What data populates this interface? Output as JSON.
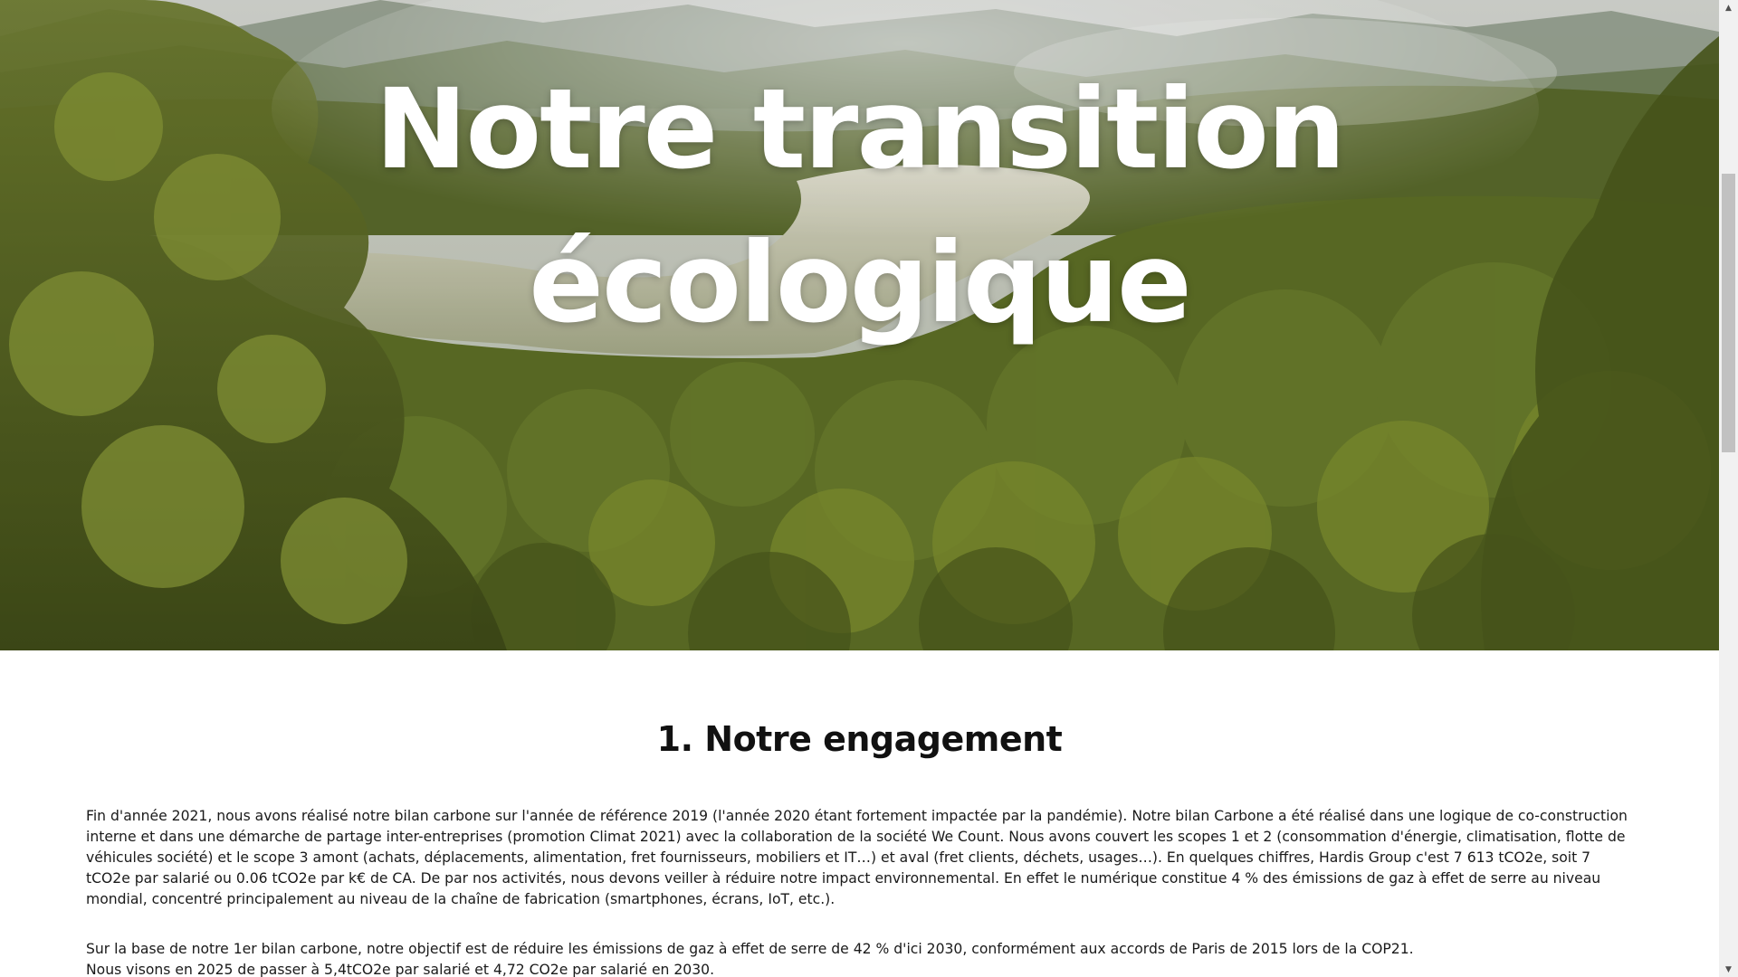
{
  "hero": {
    "title_line1": "Notre transition",
    "title_line2": "écologique",
    "image_alt": "forest-landscape-image"
  },
  "section": {
    "title": "1. Notre engagement",
    "paragraph1": "Fin d'année 2021, nous avons réalisé notre bilan carbone sur l'année de référence 2019 (l'année 2020 étant fortement impactée par la pandémie). Notre bilan Carbone a été réalisé dans une logique de co-construction interne et dans une démarche de partage inter-entreprises (promotion Climat 2021) avec la collaboration de la société We Count. Nous avons couvert les scopes 1 et 2 (consommation d'énergie, climatisation, flotte de véhicules société) et le scope 3 amont (achats, déplacements, alimentation, fret fournisseurs, mobiliers et IT…) et aval (fret clients, déchets, usages…). En quelques chiffres, Hardis Group c'est 7 613 tCO2e, soit 7 tCO2e par salarié ou 0.06 tCO2e par k€ de CA. De par nos activités, nous devons veiller à réduire notre impact environnemental. En effet le numérique constitue 4 % des émissions de gaz à effet de serre au niveau mondial, concentré principalement au niveau de la chaîne de fabrication (smartphones, écrans, IoT, etc.).",
    "paragraph2_line1": "Sur la base de notre 1er bilan carbone, notre objectif est de réduire les émissions de gaz à effet de serre de 42 % d'ici 2030, conformément aux accords de Paris de 2015 lors de la COP21.",
    "paragraph2_line2": "Nous visons en 2025 de passer à 5,4tCO2e par salarié et 4,72 CO2e par salarié en 2030."
  },
  "scrollbar": {
    "up_glyph": "▲",
    "down_glyph": "▼"
  }
}
